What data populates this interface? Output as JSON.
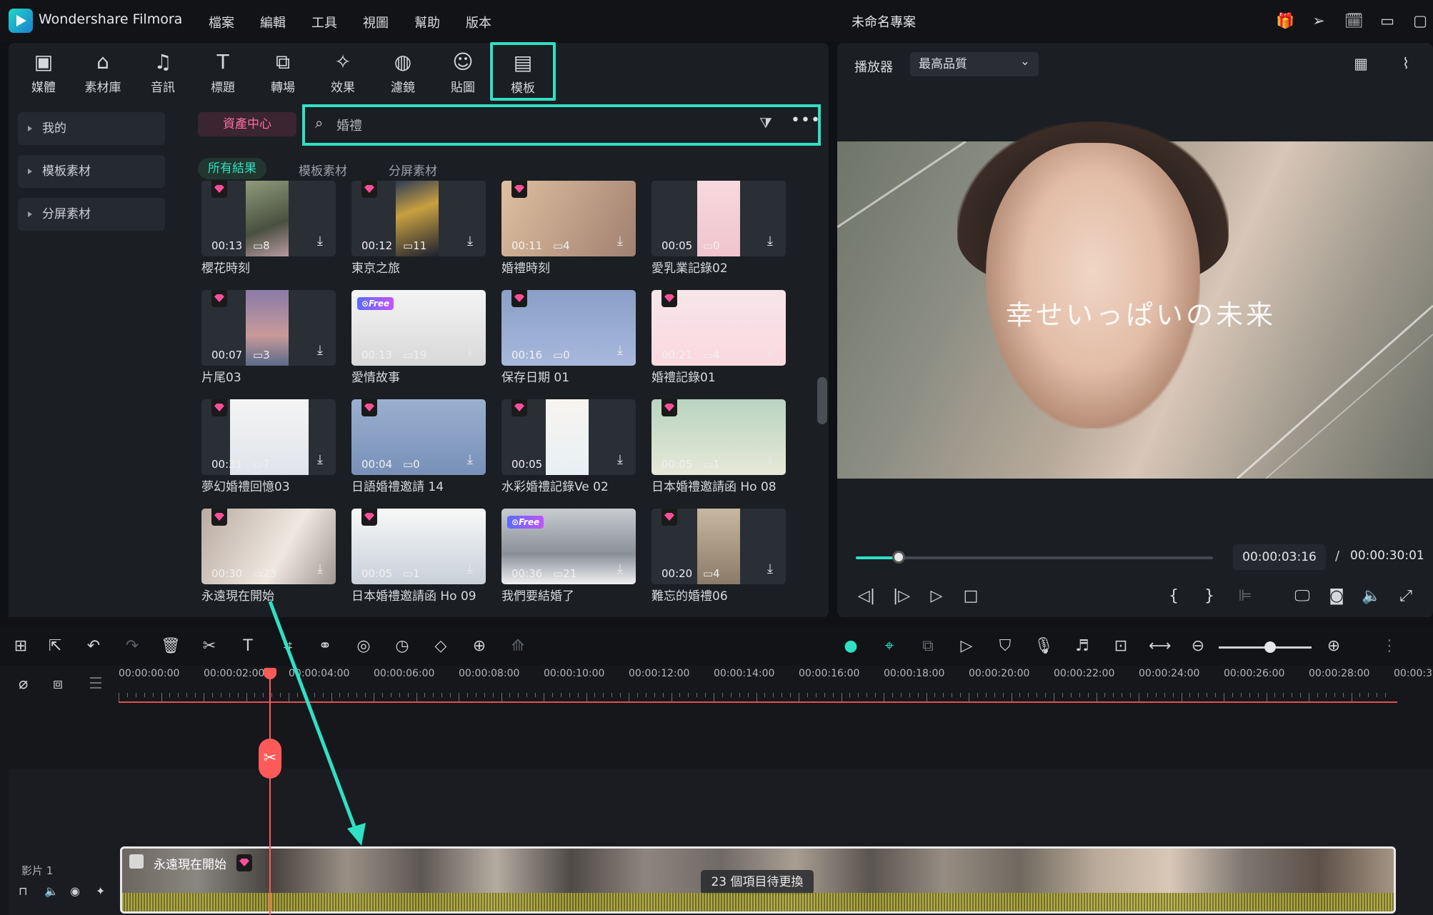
{
  "app": {
    "name": "Wondershare Filmora",
    "project": "未命名專案"
  },
  "menu": [
    "檔案",
    "編輯",
    "工具",
    "視圖",
    "幫助",
    "版本"
  ],
  "tools": [
    {
      "label": "媒體",
      "icon": "media-icon",
      "glyph": "▣"
    },
    {
      "label": "素材庫",
      "icon": "stock-icon",
      "glyph": "⌂"
    },
    {
      "label": "音訊",
      "icon": "music-icon",
      "glyph": "♫"
    },
    {
      "label": "標題",
      "icon": "title-icon",
      "glyph": "T"
    },
    {
      "label": "轉場",
      "icon": "transition-icon",
      "glyph": "⧉"
    },
    {
      "label": "效果",
      "icon": "effects-icon",
      "glyph": "✧"
    },
    {
      "label": "濾鏡",
      "icon": "filter-icon",
      "glyph": "◍"
    },
    {
      "label": "貼圖",
      "icon": "sticker-icon",
      "glyph": "☺"
    },
    {
      "label": "模板",
      "icon": "template-icon",
      "glyph": "▤"
    }
  ],
  "sidebar": {
    "items": [
      {
        "label": "我的"
      },
      {
        "label": "模板素材"
      },
      {
        "label": "分屏素材"
      }
    ]
  },
  "asset_center": "資產中心",
  "search": {
    "value": "婚禮"
  },
  "filter_tabs": [
    "所有結果",
    "模板素材",
    "分屏素材"
  ],
  "cards": [
    {
      "title": "櫻花時刻",
      "dur": "00:13",
      "count": "8",
      "badge": "gem"
    },
    {
      "title": "東京之旅",
      "dur": "00:12",
      "count": "11",
      "badge": "gem"
    },
    {
      "title": "婚禮時刻",
      "dur": "00:11",
      "count": "4",
      "badge": "gem"
    },
    {
      "title": "愛乳業記錄02",
      "dur": "00:05",
      "count": "0",
      "badge": "none"
    },
    {
      "title": "片尾03",
      "dur": "00:07",
      "count": "3",
      "badge": "gem"
    },
    {
      "title": "愛情故事",
      "dur": "00:13",
      "count": "19",
      "badge": "free"
    },
    {
      "title": "保存日期 01",
      "dur": "00:16",
      "count": "0",
      "badge": "gem"
    },
    {
      "title": "婚禮記錄01",
      "dur": "00:21",
      "count": "4",
      "badge": "gem"
    },
    {
      "title": "夢幻婚禮回憶03",
      "dur": "00:31",
      "count": "7",
      "badge": "gem"
    },
    {
      "title": "日語婚禮邀請 14",
      "dur": "00:04",
      "count": "0",
      "badge": "gem"
    },
    {
      "title": "水彩婚禮記錄Ve 02",
      "dur": "00:05",
      "count": "1",
      "badge": "gem"
    },
    {
      "title": "日本婚禮邀請函 Ho 08",
      "dur": "00:05",
      "count": "1",
      "badge": "gem"
    },
    {
      "title": "永遠現在開始",
      "dur": "00:30",
      "count": "23",
      "badge": "gem"
    },
    {
      "title": "日本婚禮邀請函 Ho 09",
      "dur": "00:05",
      "count": "1",
      "badge": "gem"
    },
    {
      "title": "我們要結婚了",
      "dur": "00:36",
      "count": "21",
      "badge": "free"
    },
    {
      "title": "難忘的婚禮06",
      "dur": "00:20",
      "count": "4",
      "badge": "gem"
    }
  ],
  "free_label": "Free",
  "preview": {
    "label": "播放器",
    "quality": "最高品質",
    "overlay_text": "幸せいっぱいの未来",
    "current": "00:00:03:16",
    "slash": "/",
    "total": "00:00:30:01",
    "progress": 0.12
  },
  "ruler": [
    "00:00:00:00",
    "00:00:02:00",
    "00:00:04:00",
    "00:00:06:00",
    "00:00:08:00",
    "00:00:10:00",
    "00:00:12:00",
    "00:00:14:00",
    "00:00:16:00",
    "00:00:18:00",
    "00:00:20:00",
    "00:00:22:00",
    "00:00:24:00",
    "00:00:26:00",
    "00:00:28:00",
    "00:00:3"
  ],
  "timeline": {
    "clip_label": "永遠現在開始",
    "replace": "23 個項目待更換",
    "track": "影片 1"
  },
  "colors": {
    "accent": "#2fe0c4",
    "playhead": "#ff5a5a",
    "gem": "#ff4f9a"
  }
}
